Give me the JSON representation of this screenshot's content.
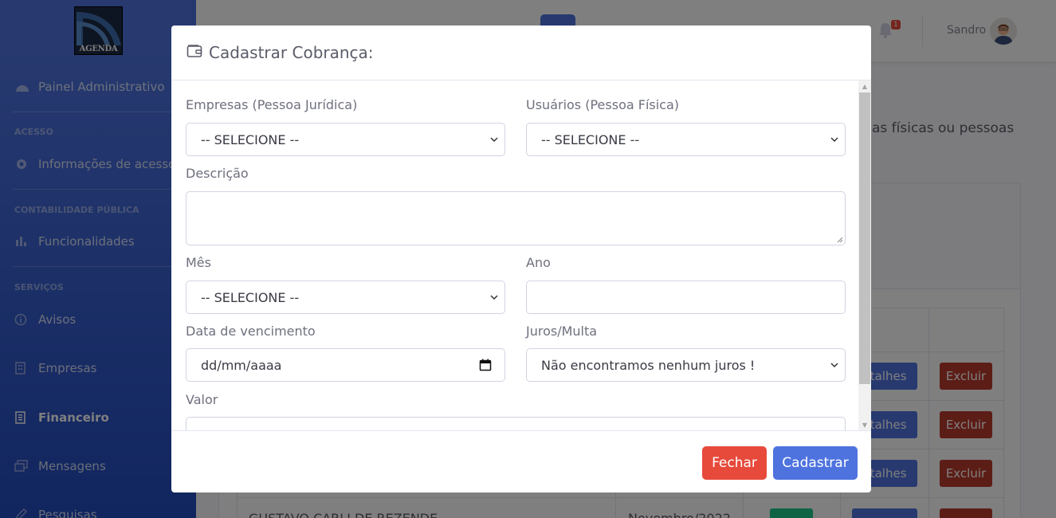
{
  "app": {
    "logo_text": "AGENDA",
    "user_name": "Sandro",
    "notification_count": "1"
  },
  "sidebar": {
    "items": [
      {
        "label": "Painel Administrativo",
        "icon": "dashboard-icon"
      },
      {
        "label": "Informações de acesso",
        "icon": "gear-icon"
      },
      {
        "label": "Funcionalidades",
        "icon": "chart-icon"
      },
      {
        "label": "Avisos",
        "icon": "info-icon"
      },
      {
        "label": "Empresas",
        "icon": "building-icon"
      },
      {
        "label": "Financeiro",
        "icon": "receipt-icon",
        "active": true
      },
      {
        "label": "Mensagens",
        "icon": "chat-icon"
      },
      {
        "label": "Pesquisas",
        "icon": "pen-icon"
      }
    ],
    "sections": [
      "ACESSO",
      "CONTABILIDADE PÚBLICA",
      "SERVIÇOS"
    ]
  },
  "background": {
    "description_fragment": "as físicas ou pessoas",
    "row_name": "GUSTAVO CARLI DE REZENDE",
    "row_month": "Novembro/2022",
    "details_label": "etalhes",
    "delete_label": "Excluir"
  },
  "modal": {
    "title": "Cadastrar Cobrança:",
    "fields": {
      "empresas_label": "Empresas (Pessoa Jurídica)",
      "empresas_value": "-- SELECIONE --",
      "usuarios_label": "Usuários (Pessoa Física)",
      "usuarios_value": "-- SELECIONE --",
      "descricao_label": "Descrição",
      "descricao_value": "",
      "mes_label": "Mês",
      "mes_value": "-- SELECIONE --",
      "ano_label": "Ano",
      "ano_value": "",
      "vencimento_label": "Data de vencimento",
      "vencimento_placeholder": "dd/mm/aaaa",
      "juros_label": "Juros/Multa",
      "juros_value": "Não encontramos nenhum juros !",
      "valor_label": "Valor"
    },
    "buttons": {
      "close": "Fechar",
      "submit": "Cadastrar"
    }
  },
  "colors": {
    "primary": "#4e73df",
    "danger": "#e74a3b",
    "success": "#1cc88a"
  }
}
